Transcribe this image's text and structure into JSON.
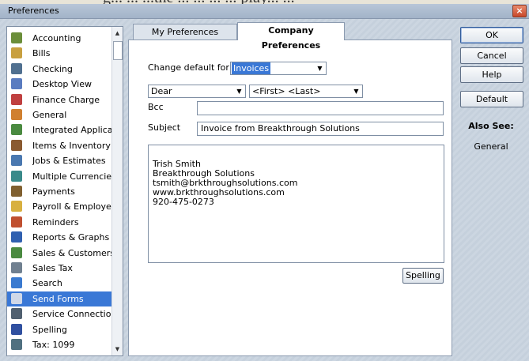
{
  "window": {
    "title": "Preferences",
    "close": "×",
    "top_banner": "g... ... ...the ... ... ... ... play... ..."
  },
  "sidebar": {
    "items": [
      {
        "label": "Accounting",
        "icon": "accounting-icon",
        "color": "#6b8e3a"
      },
      {
        "label": "Bills",
        "icon": "bills-icon",
        "color": "#c8a040"
      },
      {
        "label": "Checking",
        "icon": "checking-icon",
        "color": "#507090"
      },
      {
        "label": "Desktop View",
        "icon": "desktop-view-icon",
        "color": "#5a7cc0"
      },
      {
        "label": "Finance Charge",
        "icon": "finance-charge-icon",
        "color": "#c04040"
      },
      {
        "label": "General",
        "icon": "general-icon",
        "color": "#d08030"
      },
      {
        "label": "Integrated Applicatio",
        "icon": "integrated-apps-icon",
        "color": "#4a8a40"
      },
      {
        "label": "Items & Inventory",
        "icon": "items-inventory-icon",
        "color": "#8a5a30"
      },
      {
        "label": "Jobs & Estimates",
        "icon": "jobs-estimates-icon",
        "color": "#4a78b0"
      },
      {
        "label": "Multiple Currencies",
        "icon": "currencies-icon",
        "color": "#3a8a8a"
      },
      {
        "label": "Payments",
        "icon": "payments-icon",
        "color": "#806030"
      },
      {
        "label": "Payroll & Employees",
        "icon": "payroll-icon",
        "color": "#d8b040"
      },
      {
        "label": "Reminders",
        "icon": "reminders-icon",
        "color": "#c05030"
      },
      {
        "label": "Reports & Graphs",
        "icon": "reports-graphs-icon",
        "color": "#3060b0"
      },
      {
        "label": "Sales & Customers",
        "icon": "sales-customers-icon",
        "color": "#4a8a40"
      },
      {
        "label": "Sales Tax",
        "icon": "sales-tax-icon",
        "color": "#708090"
      },
      {
        "label": "Search",
        "icon": "search-icon",
        "color": "#3a7ad0"
      },
      {
        "label": "Send Forms",
        "icon": "send-forms-icon",
        "color": "#d0d8e8",
        "selected": true
      },
      {
        "label": "Service Connection",
        "icon": "service-connection-icon",
        "color": "#506070"
      },
      {
        "label": "Spelling",
        "icon": "spelling-icon",
        "color": "#3050a0"
      },
      {
        "label": "Tax: 1099",
        "icon": "tax-1099-icon",
        "color": "#507080"
      }
    ]
  },
  "tabs": {
    "my_prefs": "My Preferences",
    "company_prefs": "Company Preferences"
  },
  "form": {
    "change_default_label": "Change default for",
    "change_default_value": "Invoices",
    "greeting_value": "Dear",
    "name_format_value": "<First> <Last>",
    "bcc_label": "Bcc",
    "bcc_value": "",
    "subject_label": "Subject",
    "subject_value": "Invoice from Breakthrough Solutions",
    "body_lines": [
      "Trish Smith",
      "Breakthrough Solutions",
      "tsmith@brkthroughsolutions.com",
      "www.brkthroughsolutions.com",
      "920-475-0273"
    ],
    "spelling_button": "Spelling"
  },
  "actions": {
    "ok": "OK",
    "cancel": "Cancel",
    "help": "Help",
    "default": "Default"
  },
  "also_see": {
    "heading": "Also See:",
    "link": "General"
  }
}
